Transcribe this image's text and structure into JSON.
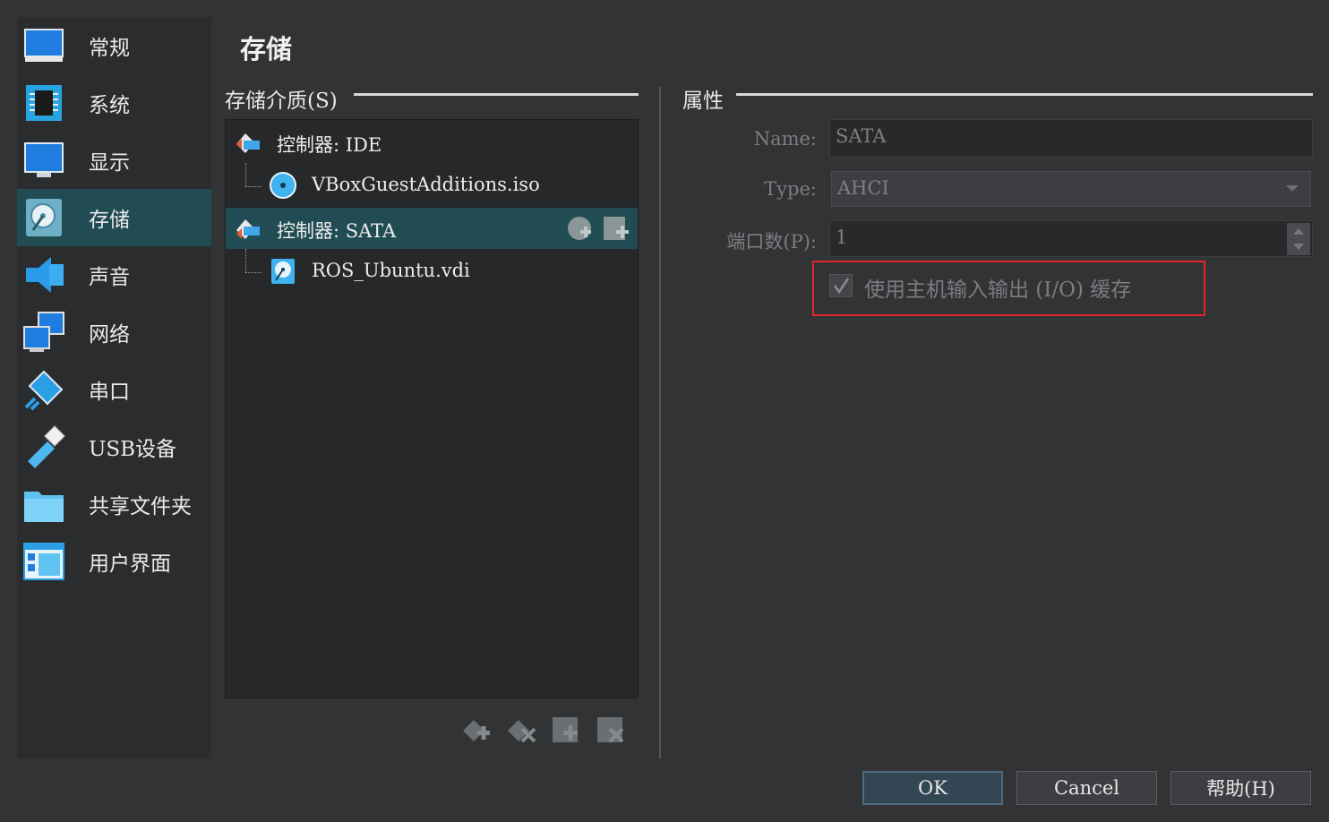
{
  "sidebar": {
    "items": [
      {
        "label": "常规",
        "icon": "monitor-icon"
      },
      {
        "label": "系统",
        "icon": "chip-icon"
      },
      {
        "label": "显示",
        "icon": "display-icon"
      },
      {
        "label": "存储",
        "icon": "disk-icon",
        "selected": true
      },
      {
        "label": "声音",
        "icon": "speaker-icon"
      },
      {
        "label": "网络",
        "icon": "network-icon"
      },
      {
        "label": "串口",
        "icon": "serial-port-icon"
      },
      {
        "label": "USB设备",
        "icon": "usb-icon"
      },
      {
        "label": "共享文件夹",
        "icon": "folder-icon"
      },
      {
        "label": "用户界面",
        "icon": "window-icon"
      }
    ]
  },
  "page": {
    "title": "存储"
  },
  "storage": {
    "section_title": "存储介质(S)",
    "tree": {
      "ide_controller": "控制器: IDE",
      "ide_child": "VBoxGuestAdditions.iso",
      "sata_controller": "控制器: SATA",
      "sata_child": "ROS_Ubuntu.vdi"
    }
  },
  "properties": {
    "section_title": "属性",
    "name_label": "Name:",
    "name_value": "SATA",
    "type_label": "Type:",
    "type_value": "AHCI",
    "port_label": "端口数(P):",
    "port_value": "1",
    "cache_checked": true,
    "cache_label": "使用主机输入输出 (I/O) 缓存"
  },
  "buttons": {
    "ok": "OK",
    "cancel": "Cancel",
    "help": "帮助(H)"
  },
  "colors": {
    "accent_selected": "#214c53",
    "highlight": "#e0262d"
  }
}
